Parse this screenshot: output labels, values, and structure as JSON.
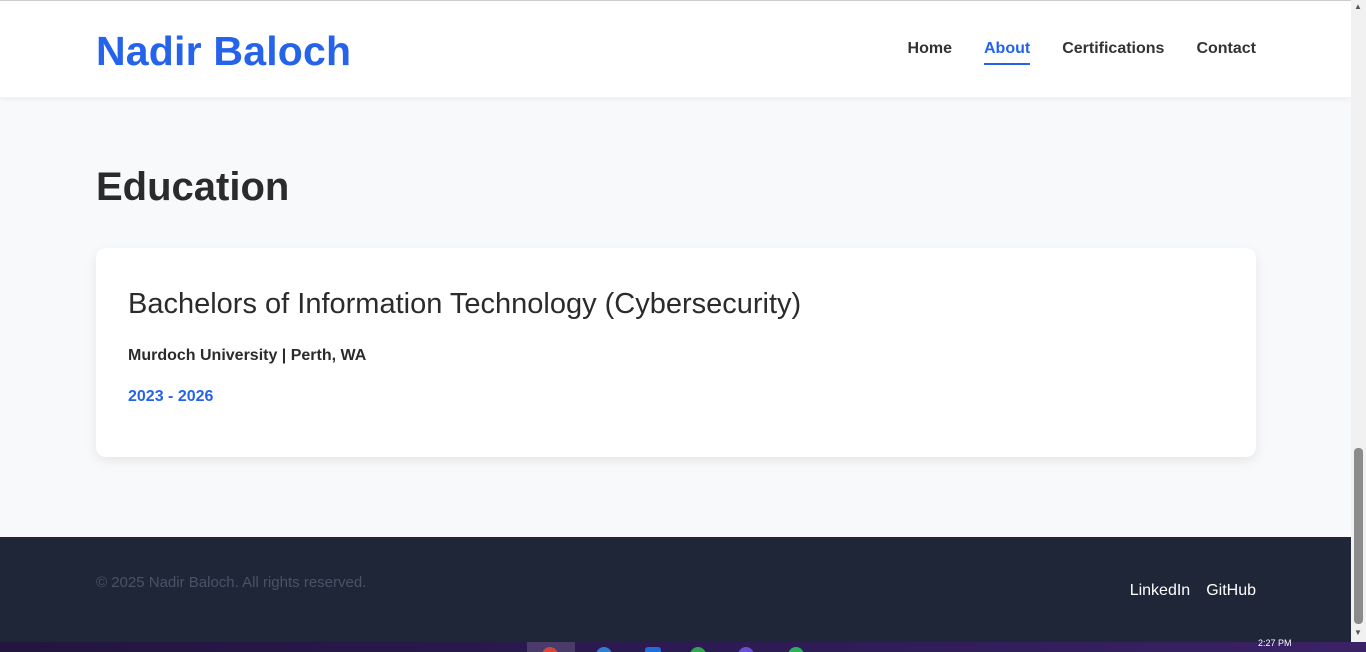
{
  "header": {
    "brand": "Nadir Baloch",
    "nav": [
      "Home",
      "About",
      "Certifications",
      "Contact"
    ],
    "active_nav": "About"
  },
  "education": {
    "title": "Education",
    "degree": "Bachelors of Information Technology (Cybersecurity)",
    "school": "Murdoch University | Perth, WA",
    "years": "2023 - 2026"
  },
  "footer": {
    "copyright": "© 2025 Nadir Baloch. All rights reserved.",
    "links": [
      "LinkedIn",
      "GitHub"
    ]
  },
  "taskbar": {
    "clock": "2:27 PM"
  },
  "colors": {
    "accent": "#2563eb",
    "footer_bg": "#1e2638",
    "page_bg": "#f8f9fb"
  },
  "scroll": {
    "position_fraction": 1.0
  }
}
